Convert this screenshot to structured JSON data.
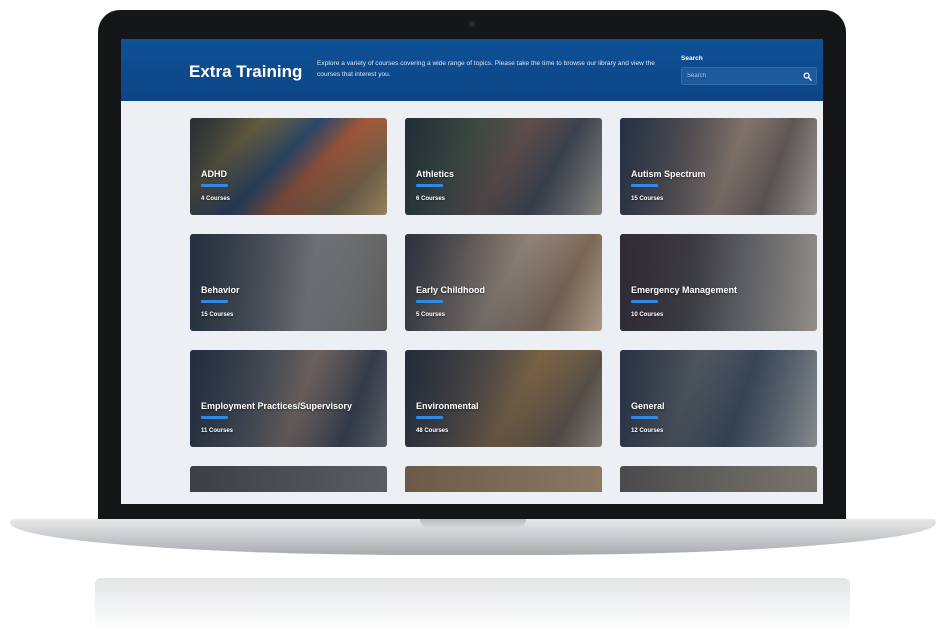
{
  "header": {
    "title": "Extra Training",
    "description": "Explore a variety of courses covering a wide range of topics. Please take the time to browse our library and view the courses that interest you.",
    "search_label": "Search",
    "search_placeholder": "Search",
    "search_icon": "search-icon"
  },
  "categories": [
    {
      "title": "ADHD",
      "count": "4 Courses"
    },
    {
      "title": "Athletics",
      "count": "6 Courses"
    },
    {
      "title": "Autism Spectrum",
      "count": "15 Courses"
    },
    {
      "title": "Behavior",
      "count": "15 Courses"
    },
    {
      "title": "Early Childhood",
      "count": "5 Courses"
    },
    {
      "title": "Emergency Management",
      "count": "10 Courses"
    },
    {
      "title": "Employment Practices/Supervisory",
      "count": "11 Courses"
    },
    {
      "title": "Environmental",
      "count": "48 Courses"
    },
    {
      "title": "General",
      "count": "12 Courses"
    }
  ],
  "colors": {
    "header_bg": "#0c4585",
    "accent_bar": "#2e8ae6",
    "page_bg": "#eceff3"
  }
}
